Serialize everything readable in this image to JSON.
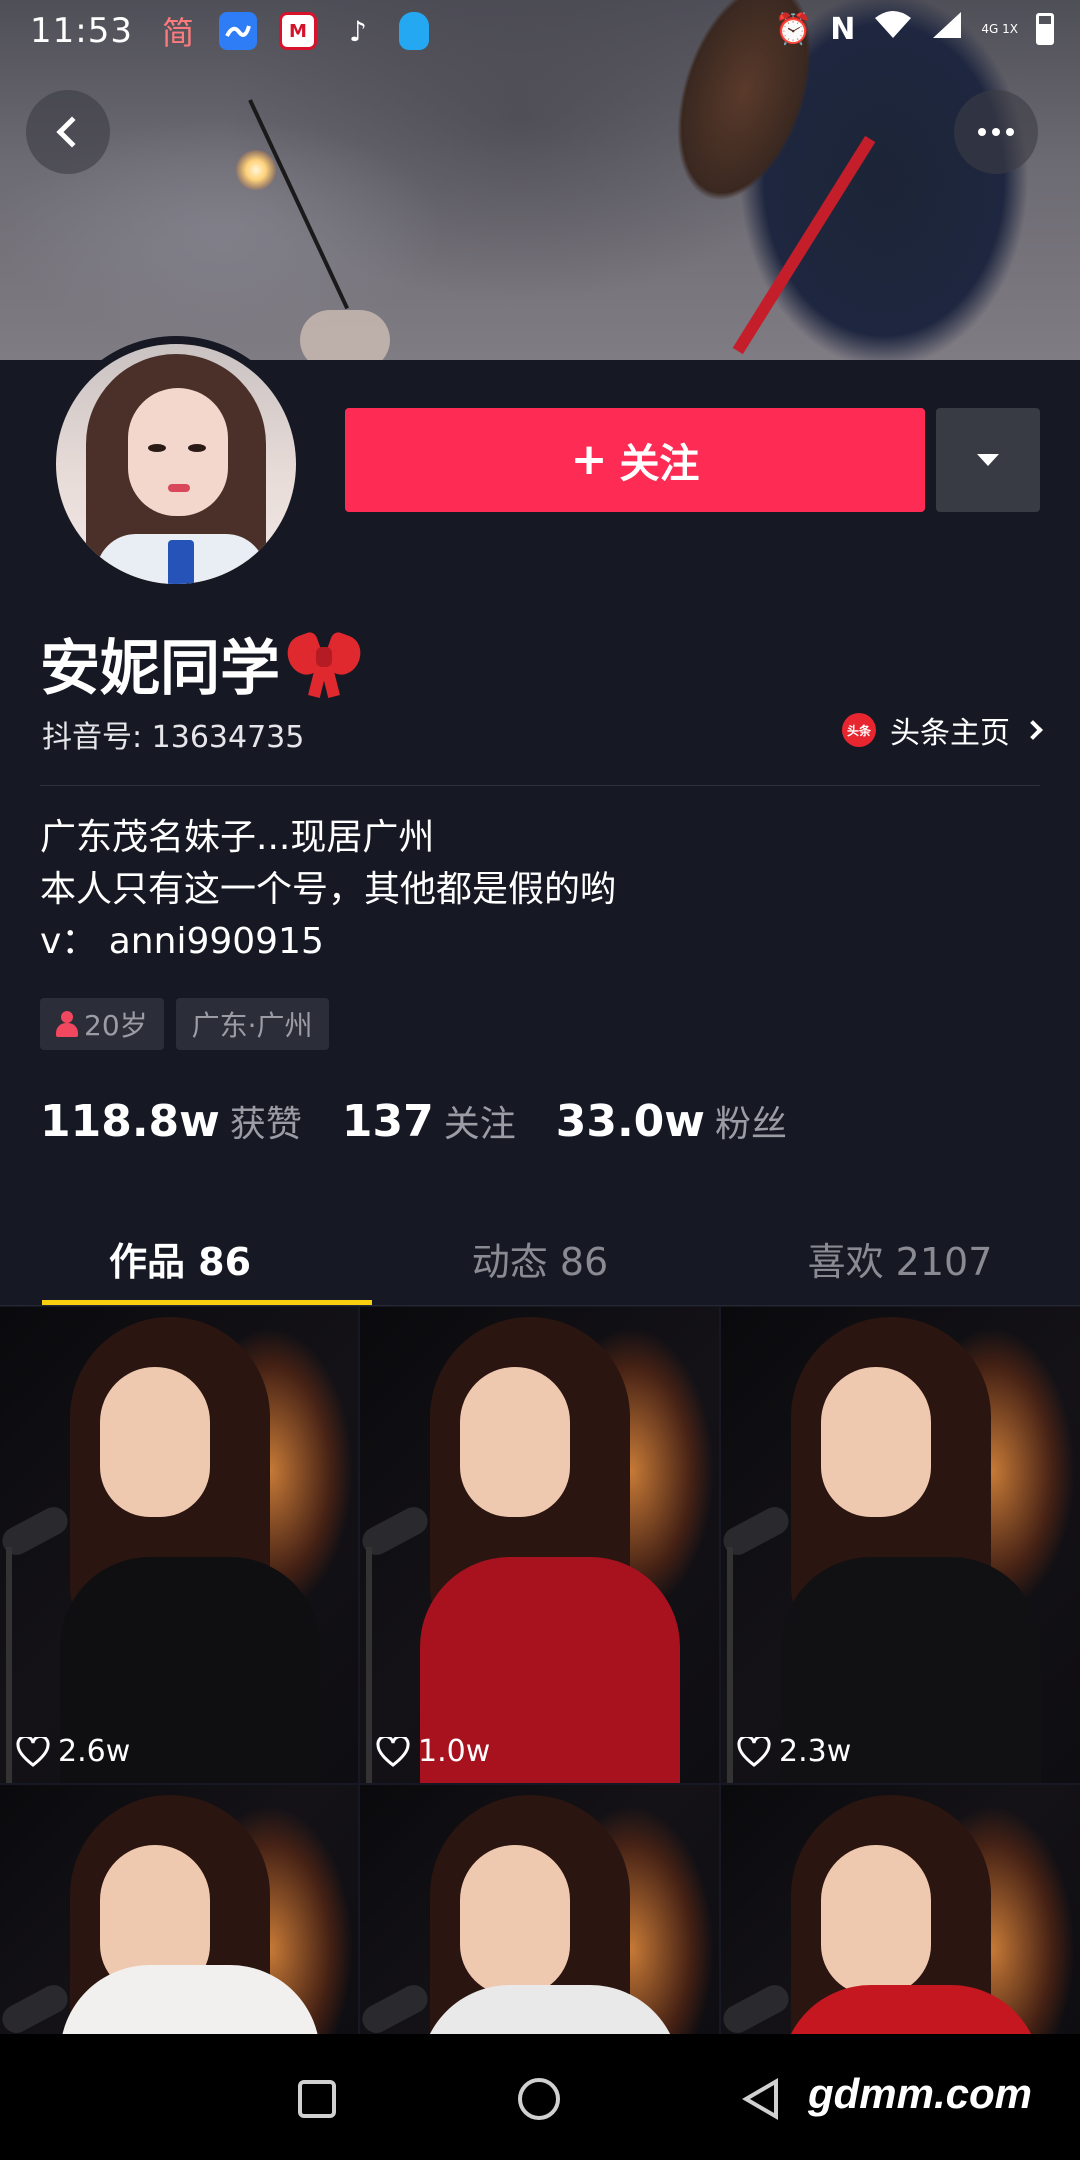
{
  "status_bar": {
    "time": "11:53",
    "left_icons": [
      "jian-text-icon",
      "blue-app-icon",
      "red-app-icon",
      "tiktok-icon",
      "qq-icon"
    ],
    "jian_label": "简",
    "network_label": "4G 1X"
  },
  "profile": {
    "display_name": "安妮同学",
    "douyin_id": "抖音号: 13634735",
    "toutiao_label": "头条主页",
    "toutiao_icon_text": "头条",
    "follow_label": "关注",
    "bio_lines": [
      "广东茂名妹子...现居广州",
      "本人只有这一个号，其他都是假的哟",
      "v： anni990915"
    ],
    "tags": [
      "20岁",
      "广东·广州"
    ],
    "stats": [
      {
        "value": "118.8w",
        "label": "获赞"
      },
      {
        "value": "137",
        "label": "关注"
      },
      {
        "value": "33.0w",
        "label": "粉丝"
      }
    ]
  },
  "tabs": [
    {
      "label": "作品 86",
      "active": true
    },
    {
      "label": "动态 86",
      "active": false
    },
    {
      "label": "喜欢 2107",
      "active": false
    }
  ],
  "videos": [
    {
      "likes": "2.6w",
      "dress_color": "#0f0f12"
    },
    {
      "likes": "1.0w",
      "dress_color": "#a8121f"
    },
    {
      "likes": "2.3w",
      "dress_color": "#111114"
    },
    {
      "likes": "",
      "dress_color": "#f2f0ee"
    },
    {
      "likes": "",
      "dress_color": "#e9e9ea"
    },
    {
      "likes": "",
      "dress_color": "#c4171f"
    }
  ],
  "watermark": "gdmm.com",
  "colors": {
    "accent": "#fe2c55",
    "background": "#161823",
    "tab_indicator": "#facf0f"
  }
}
